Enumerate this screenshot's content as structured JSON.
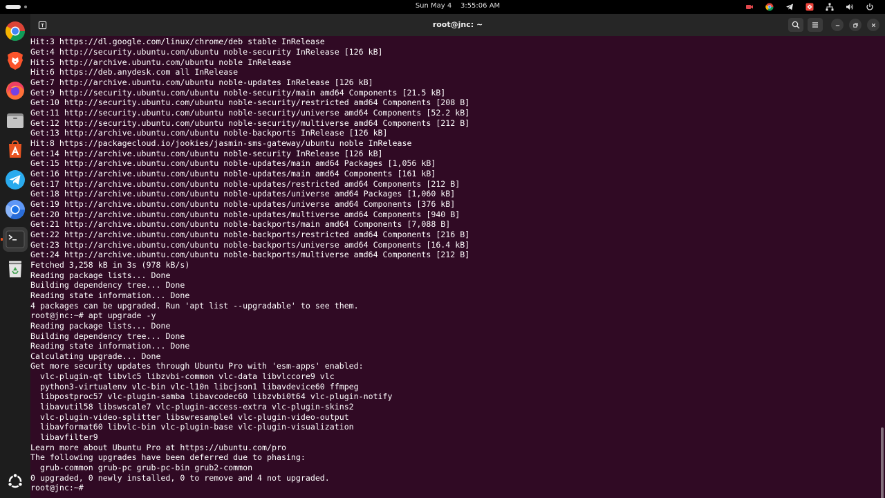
{
  "topbar": {
    "clock": "Sun May 4    3:55:06 AM",
    "tray_icons": [
      "screen-record-icon",
      "chrome-icon",
      "telegram-icon",
      "anydesk-icon",
      "network-icon",
      "volume-icon",
      "power-icon"
    ]
  },
  "dock": {
    "items": [
      {
        "name": "google-chrome",
        "icon": "chrome-icon"
      },
      {
        "name": "brave-browser",
        "icon": "brave-icon"
      },
      {
        "name": "firefox",
        "icon": "firefox-icon"
      },
      {
        "name": "files",
        "icon": "files-icon"
      },
      {
        "name": "app-center",
        "icon": "app-center-icon"
      },
      {
        "name": "telegram",
        "icon": "telegram-icon"
      },
      {
        "name": "chromium",
        "icon": "chromium-icon"
      },
      {
        "name": "terminal",
        "icon": "terminal-icon"
      },
      {
        "name": "trash",
        "icon": "trash-icon"
      }
    ],
    "show_apps_icon": "ubuntu-logo-icon"
  },
  "window": {
    "title": "root@jnc: ~",
    "buttons": [
      "search-icon",
      "menu-icon",
      "minimize-icon",
      "maximize-icon",
      "close-icon"
    ]
  },
  "colors": {
    "terminal_bg": "#300a24",
    "titlebar_bg": "#262626",
    "accent": "#e95420"
  },
  "terminal": {
    "lines": [
      "Hit:3 https://dl.google.com/linux/chrome/deb stable InRelease",
      "Get:4 http://security.ubuntu.com/ubuntu noble-security InRelease [126 kB]",
      "Hit:5 http://archive.ubuntu.com/ubuntu noble InRelease",
      "Hit:6 https://deb.anydesk.com all InRelease",
      "Get:7 http://archive.ubuntu.com/ubuntu noble-updates InRelease [126 kB]",
      "Get:9 http://security.ubuntu.com/ubuntu noble-security/main amd64 Components [21.5 kB]",
      "Get:10 http://security.ubuntu.com/ubuntu noble-security/restricted amd64 Components [208 B]",
      "Get:11 http://security.ubuntu.com/ubuntu noble-security/universe amd64 Components [52.2 kB]",
      "Get:12 http://security.ubuntu.com/ubuntu noble-security/multiverse amd64 Components [212 B]",
      "Get:13 http://archive.ubuntu.com/ubuntu noble-backports InRelease [126 kB]",
      "Hit:8 https://packagecloud.io/jookies/jasmin-sms-gateway/ubuntu noble InRelease",
      "Get:14 http://archive.ubuntu.com/ubuntu noble-security InRelease [126 kB]",
      "Get:15 http://archive.ubuntu.com/ubuntu noble-updates/main amd64 Packages [1,056 kB]",
      "Get:16 http://archive.ubuntu.com/ubuntu noble-updates/main amd64 Components [161 kB]",
      "Get:17 http://archive.ubuntu.com/ubuntu noble-updates/restricted amd64 Components [212 B]",
      "Get:18 http://archive.ubuntu.com/ubuntu noble-updates/universe amd64 Packages [1,060 kB]",
      "Get:19 http://archive.ubuntu.com/ubuntu noble-updates/universe amd64 Components [376 kB]",
      "Get:20 http://archive.ubuntu.com/ubuntu noble-updates/multiverse amd64 Components [940 B]",
      "Get:21 http://archive.ubuntu.com/ubuntu noble-backports/main amd64 Components [7,088 B]",
      "Get:22 http://archive.ubuntu.com/ubuntu noble-backports/restricted amd64 Components [216 B]",
      "Get:23 http://archive.ubuntu.com/ubuntu noble-backports/universe amd64 Components [16.4 kB]",
      "Get:24 http://archive.ubuntu.com/ubuntu noble-backports/multiverse amd64 Components [212 B]",
      "Fetched 3,258 kB in 3s (978 kB/s)",
      "Reading package lists... Done",
      "Building dependency tree... Done",
      "Reading state information... Done",
      "4 packages can be upgraded. Run 'apt list --upgradable' to see them.",
      "root@jnc:~# apt upgrade -y",
      "Reading package lists... Done",
      "Building dependency tree... Done",
      "Reading state information... Done",
      "Calculating upgrade... Done",
      "Get more security updates through Ubuntu Pro with 'esm-apps' enabled:",
      "  vlc-plugin-qt libvlc5 libzvbi-common vlc-data libvlccore9 vlc",
      "  python3-virtualenv vlc-bin vlc-l10n libcjson1 libavdevice60 ffmpeg",
      "  libpostproc57 vlc-plugin-samba libavcodec60 libzvbi0t64 vlc-plugin-notify",
      "  libavutil58 libswscale7 vlc-plugin-access-extra vlc-plugin-skins2",
      "  vlc-plugin-video-splitter libswresample4 vlc-plugin-video-output",
      "  libavformat60 libvlc-bin vlc-plugin-base vlc-plugin-visualization",
      "  libavfilter9",
      "Learn more about Ubuntu Pro at https://ubuntu.com/pro",
      "The following upgrades have been deferred due to phasing:",
      "  grub-common grub-pc grub-pc-bin grub2-common",
      "0 upgraded, 0 newly installed, 0 to remove and 4 not upgraded.",
      "root@jnc:~# "
    ]
  }
}
